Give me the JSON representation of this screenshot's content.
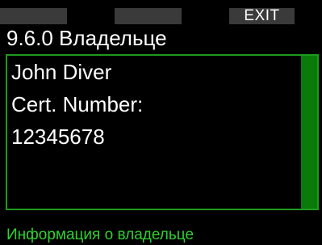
{
  "softkeys": {
    "left_label": "",
    "middle_label": "",
    "right_label": "EXIT"
  },
  "header": {
    "title": "9.6.0 Владельце"
  },
  "owner": {
    "lines": [
      "John Diver",
      "Cert. Number:",
      "12345678"
    ]
  },
  "status": {
    "text": "Информация о владельце"
  },
  "colors": {
    "accent": "#1e9a1e",
    "status_text": "#2fd12f",
    "softkey_bg": "#3a3a3a",
    "background": "#000000"
  }
}
